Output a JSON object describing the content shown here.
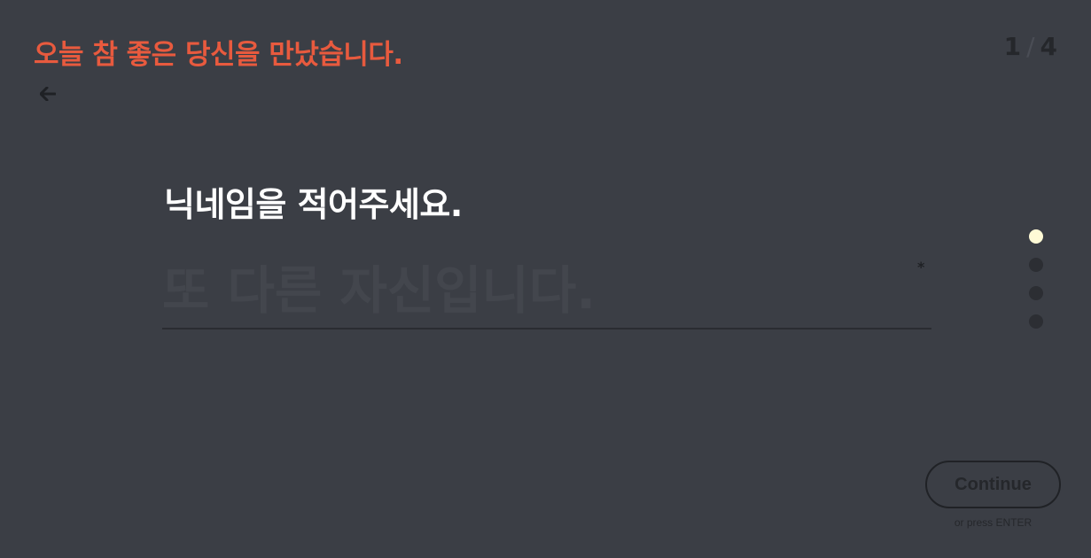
{
  "header": {
    "title": "오늘 참 좋은 당신을 만났습니다."
  },
  "progress": {
    "current": "1",
    "separator": "/",
    "total": "4"
  },
  "navigation": {
    "back_icon": "arrow-left-icon"
  },
  "question": {
    "text": "닉네임을 적어주세요.",
    "required_symbol": "*"
  },
  "answer": {
    "value": "",
    "placeholder": "또 다른 자신입니다."
  },
  "steps": {
    "count": 4,
    "active_index": 0
  },
  "actions": {
    "continue_label": "Continue",
    "enter_hint": "or press ENTER"
  },
  "colors": {
    "background": "#3b3e45",
    "accent": "#e85a3e",
    "active_dot": "#fffad6",
    "text": "#ffffff"
  }
}
